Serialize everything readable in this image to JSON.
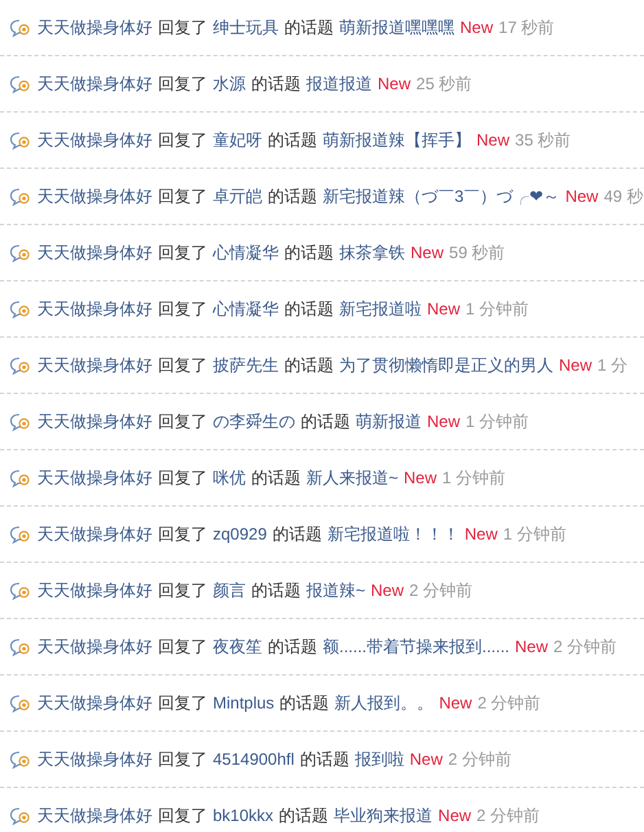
{
  "activity_feed": [
    {
      "user": "天天做操身体好",
      "action": "回复了",
      "author": "绅士玩具",
      "connector": "的话题",
      "topic": "萌新报道嘿嘿嘿",
      "badge": "New",
      "time": "17 秒前"
    },
    {
      "user": "天天做操身体好",
      "action": "回复了",
      "author": "水源",
      "connector": "的话题",
      "topic": "报道报道",
      "badge": "New",
      "time": "25 秒前"
    },
    {
      "user": "天天做操身体好",
      "action": "回复了",
      "author": "童妃呀",
      "connector": "的话题",
      "topic": "萌新报道辣【挥手】",
      "badge": "New",
      "time": "35 秒前"
    },
    {
      "user": "天天做操身体好",
      "action": "回复了",
      "author": "卓亓皑",
      "connector": "的话题",
      "topic": "新宅报道辣（づ￣3￣）づ╭❤～",
      "badge": "New",
      "time": "49 秒"
    },
    {
      "user": "天天做操身体好",
      "action": "回复了",
      "author": "心情凝华",
      "connector": "的话题",
      "topic": "抹茶拿铁",
      "badge": "New",
      "time": "59 秒前"
    },
    {
      "user": "天天做操身体好",
      "action": "回复了",
      "author": "心情凝华",
      "connector": "的话题",
      "topic": "新宅报道啦",
      "badge": "New",
      "time": "1 分钟前"
    },
    {
      "user": "天天做操身体好",
      "action": "回复了",
      "author": "披萨先生",
      "connector": "的话题",
      "topic": "为了贯彻懒惰即是正义的男人",
      "badge": "New",
      "time": "1 分"
    },
    {
      "user": "天天做操身体好",
      "action": "回复了",
      "author": "の李舜生の",
      "connector": "的话题",
      "topic": "萌新报道",
      "badge": "New",
      "time": "1 分钟前"
    },
    {
      "user": "天天做操身体好",
      "action": "回复了",
      "author": "咪优",
      "connector": "的话题",
      "topic": "新人来报道~",
      "badge": "New",
      "time": "1 分钟前"
    },
    {
      "user": "天天做操身体好",
      "action": "回复了",
      "author": "zq0929",
      "connector": "的话题",
      "topic": "新宅报道啦！！！",
      "badge": "New",
      "time": "1 分钟前"
    },
    {
      "user": "天天做操身体好",
      "action": "回复了",
      "author": "颜言",
      "connector": "的话题",
      "topic": "报道辣~",
      "badge": "New",
      "time": "2 分钟前"
    },
    {
      "user": "天天做操身体好",
      "action": "回复了",
      "author": "夜夜笙",
      "connector": "的话题",
      "topic": "额......带着节操来报到......",
      "badge": "New",
      "time": "2 分钟前"
    },
    {
      "user": "天天做操身体好",
      "action": "回复了",
      "author": "Mintplus",
      "connector": "的话题",
      "topic": "新人报到。。",
      "badge": "New",
      "time": "2 分钟前"
    },
    {
      "user": "天天做操身体好",
      "action": "回复了",
      "author": "4514900hfl",
      "connector": "的话题",
      "topic": "报到啦",
      "badge": "New",
      "time": "2 分钟前"
    },
    {
      "user": "天天做操身体好",
      "action": "回复了",
      "author": "bk10kkx",
      "connector": "的话题",
      "topic": "毕业狗来报道",
      "badge": "New",
      "time": "2 分钟前"
    }
  ]
}
